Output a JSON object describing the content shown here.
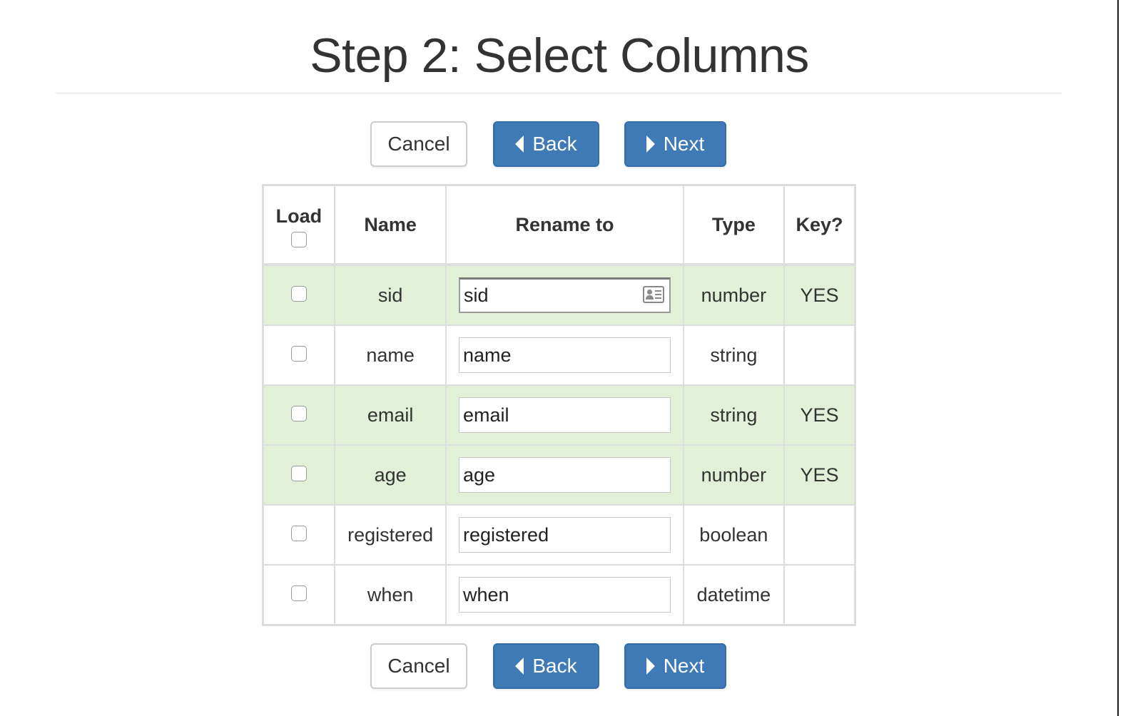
{
  "page": {
    "title": "Step 2: Select Columns"
  },
  "buttons": {
    "cancel_label": "Cancel",
    "back_label": "Back",
    "next_label": "Next"
  },
  "table": {
    "headers": {
      "load": "Load",
      "name": "Name",
      "rename": "Rename to",
      "type": "Type",
      "key": "Key?"
    },
    "rows": [
      {
        "name": "sid",
        "rename": "sid",
        "type": "number",
        "key": "YES",
        "load_checked": false
      },
      {
        "name": "name",
        "rename": "name",
        "type": "string",
        "key": "",
        "load_checked": false
      },
      {
        "name": "email",
        "rename": "email",
        "type": "string",
        "key": "YES",
        "load_checked": false
      },
      {
        "name": "age",
        "rename": "age",
        "type": "number",
        "key": "YES",
        "load_checked": false
      },
      {
        "name": "registered",
        "rename": "registered",
        "type": "boolean",
        "key": "",
        "load_checked": false
      },
      {
        "name": "when",
        "rename": "when",
        "type": "datetime",
        "key": "",
        "load_checked": false
      }
    ]
  },
  "icons": {
    "autofill": "contact-card-icon",
    "back": "caret-left-icon",
    "next": "caret-right-icon"
  },
  "colors": {
    "primary_button": "#3f7ab7",
    "key_row_highlight": "#e3f0d9",
    "border": "#dddddd"
  }
}
